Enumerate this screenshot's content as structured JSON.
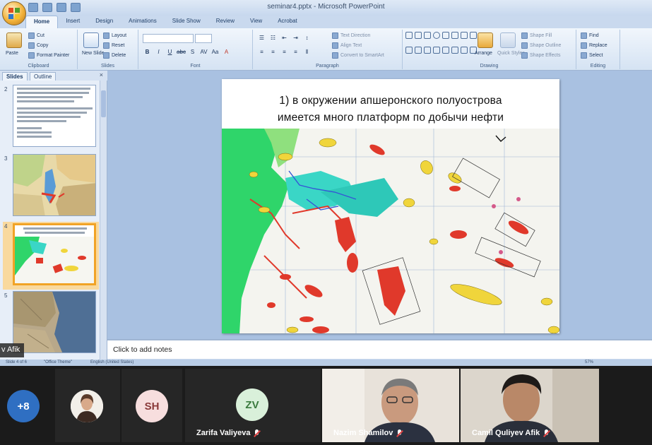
{
  "window": {
    "title": "seminar4.pptx - Microsoft PowerPoint"
  },
  "ribbon": {
    "tabs": [
      "Home",
      "Insert",
      "Design",
      "Animations",
      "Slide Show",
      "Review",
      "View",
      "Acrobat"
    ],
    "active_tab": "Home",
    "clipboard": {
      "label": "Clipboard",
      "paste": "Paste",
      "cut": "Cut",
      "copy": "Copy",
      "format_painter": "Format Painter"
    },
    "slides": {
      "label": "Slides",
      "new_slide": "New Slide",
      "layout": "Layout",
      "reset": "Reset",
      "delete": "Delete"
    },
    "font": {
      "label": "Font"
    },
    "paragraph": {
      "label": "Paragraph",
      "text_direction": "Text Direction",
      "align_text": "Align Text",
      "convert_smartart": "Convert to SmartArt"
    },
    "drawing": {
      "label": "Drawing",
      "arrange": "Arrange",
      "quick_styles": "Quick Styles",
      "shape_fill": "Shape Fill",
      "shape_outline": "Shape Outline",
      "shape_effects": "Shape Effects"
    },
    "editing": {
      "label": "Editing",
      "find": "Find",
      "replace": "Replace",
      "select": "Select"
    }
  },
  "slide_pane": {
    "tabs": [
      "Slides",
      "Outline"
    ],
    "close": "×",
    "thumbnails": [
      {
        "number": "2"
      },
      {
        "number": "3"
      },
      {
        "number": "4"
      },
      {
        "number": "5"
      }
    ]
  },
  "slide": {
    "title_line1": "1) в окружении апшеронского полуострова",
    "title_line2": "имеется много платформ по добычи нефти"
  },
  "notes": {
    "placeholder": "Click to add notes"
  },
  "status": {
    "slide_info": "Slide 4 of 6",
    "theme": "\"Office Theme\"",
    "language": "English (United States)",
    "zoom": "57%"
  },
  "presenter_tag": "v Afik",
  "participants": [
    {
      "initials": "+8",
      "color": "#2f6fc2"
    },
    {
      "initials": "",
      "color": "#ffffff"
    },
    {
      "initials": "SH",
      "color": "#f7dede"
    },
    {
      "initials": "ZV",
      "color": "#d9f0da",
      "name": "Zarifa Valiyeva",
      "muted": true
    },
    {
      "name": "Nazim Shamilov",
      "muted": true
    },
    {
      "name": "Camil Quliyev Afik",
      "muted": true
    }
  ]
}
